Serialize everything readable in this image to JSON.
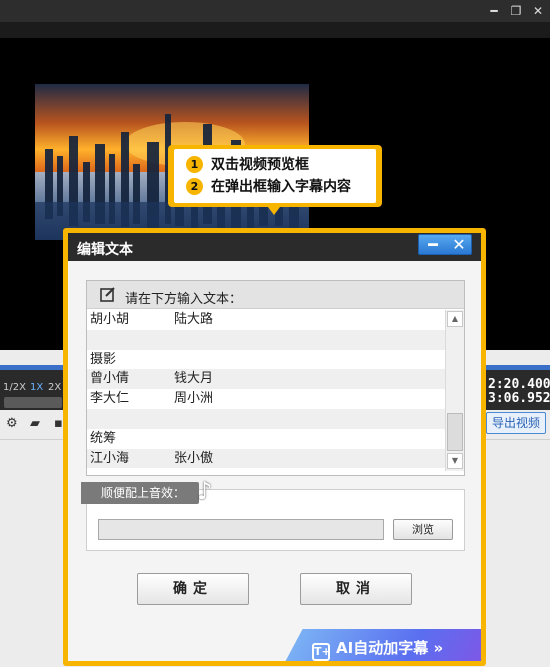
{
  "window": {
    "minimize_icon": "minimize-icon",
    "restore_icon": "restore-icon",
    "close_icon": "close-icon"
  },
  "tooltip": {
    "steps": [
      {
        "num": "1",
        "text": "双击视频预览框"
      },
      {
        "num": "2",
        "text": "在弹出框输入字幕内容"
      }
    ],
    "accent_color": "#f7b500"
  },
  "timeline": {
    "zoom_options": [
      "1/2X",
      "1X",
      "2X"
    ],
    "selected_zoom": "1X",
    "time_current": "2:20.400",
    "time_total": "3:06.952",
    "export_label": "导出视频"
  },
  "dialog": {
    "title": "编辑文本",
    "panel_label": "请在下方输入文本：",
    "lines": [
      [
        "胡小胡",
        "陆大路"
      ],
      [
        "",
        ""
      ],
      [
        "摄影",
        ""
      ],
      [
        "曾小倩",
        "钱大月"
      ],
      [
        "李大仁",
        "周小洲"
      ],
      [
        "",
        ""
      ],
      [
        "统筹",
        ""
      ],
      [
        "江小海",
        "张小傲"
      ]
    ],
    "sound_label": "顺便配上音效：",
    "sound_path": "",
    "browse_label": "浏览",
    "ok_label": "确定",
    "cancel_label": "取消",
    "ai_label": "AI自动加字幕",
    "ai_chevron": "»",
    "border_color": "#f7b500"
  }
}
